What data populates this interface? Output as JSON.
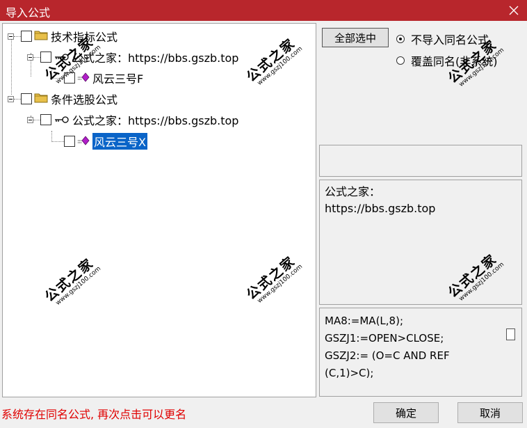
{
  "window": {
    "title": "导入公式"
  },
  "tree": {
    "nodes": [
      {
        "label": "技术指标公式",
        "kind": "folder"
      },
      {
        "label": "公式之家：https://bbs.gszb.top",
        "kind": "key"
      },
      {
        "label": "风云三号F",
        "kind": "formula"
      },
      {
        "label": "条件选股公式",
        "kind": "folder"
      },
      {
        "label": "公式之家：https://bbs.gszb.top",
        "kind": "key"
      },
      {
        "label": "风云三号X",
        "kind": "formula",
        "selected": true
      }
    ]
  },
  "right": {
    "select_all_label": "全部选中",
    "radio_options": [
      {
        "label": "不导入同名公式",
        "checked": true
      },
      {
        "label": "覆盖同名(非系统)",
        "checked": false
      }
    ],
    "description": "公式之家：\nhttps://bbs.gszb.top",
    "code": "MA8:=MA(L,8);\nGSZJ1:=OPEN>CLOSE;\nGSZJ2:= (O=C AND REF\n(C,1)>C);"
  },
  "footer": {
    "status": "系统存在同名公式, 再次点击可以更名",
    "ok_label": "确定",
    "cancel_label": "取消"
  },
  "watermark": {
    "brand": "公式之家",
    "url": "www.gszj100.com"
  },
  "colors": {
    "titlebar": "#b8262c",
    "selection": "#0a64c8",
    "status_text": "#e00000",
    "folder": "#e8c04a",
    "formula_diamond": "#b01ec8"
  }
}
